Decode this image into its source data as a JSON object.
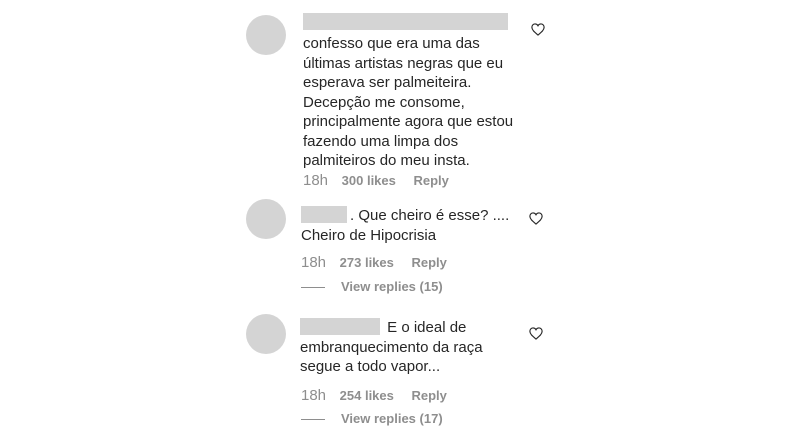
{
  "comments": [
    {
      "lines": [
        "confesso que era uma das",
        "últimas artistas negras que eu",
        "esperava ser palmeiteira.",
        "Decepção me consome,",
        "principalmente agora que estou",
        "fazendo uma limpa dos",
        "palmiteiros do meu insta."
      ],
      "time": "18h",
      "likes": "300 likes",
      "reply": "Reply"
    },
    {
      "first_line_rest": ". Que cheiro é esse? ....",
      "lines": [
        "Cheiro de Hipocrisia"
      ],
      "time": "18h",
      "likes": "273 likes",
      "reply": "Reply",
      "view_replies": "View replies (15)"
    },
    {
      "first_line_rest": " E o ideal de",
      "lines": [
        "embranquecimento da raça",
        "segue a todo vapor..."
      ],
      "time": "18h",
      "likes": "254 likes",
      "reply": "Reply",
      "view_replies": "View replies (17)"
    }
  ]
}
